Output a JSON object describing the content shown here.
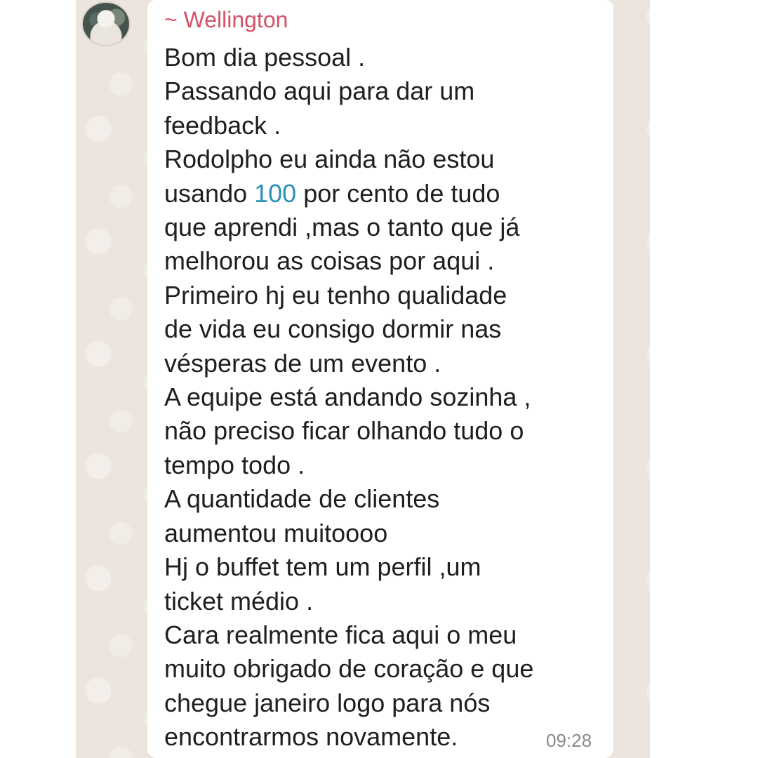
{
  "chat": {
    "wallpaper_color": "#ece5dd",
    "bubble_color": "#ffffff"
  },
  "message": {
    "sender": "~ Wellington",
    "sender_color": "#d5536a",
    "time": "09:28",
    "highlight_color": "#2b8fb4",
    "lines": [
      "Bom dia pessoal .",
      "Passando aqui para dar um",
      "feedback .",
      "Rodolpho eu ainda não estou",
      {
        "before": "usando ",
        "number": "100",
        "after": " por cento de tudo"
      },
      "que aprendi ,mas o tanto que já",
      "melhorou as coisas por aqui .",
      "Primeiro hj eu tenho qualidade",
      "de vida eu consigo dormir nas",
      "vésperas de um evento .",
      "A equipe está andando sozinha ,",
      "não preciso ficar olhando tudo o",
      "tempo todo .",
      "A quantidade de clientes",
      "aumentou muitoooo",
      "Hj o buffet tem um perfil ,um",
      "ticket médio .",
      "Cara realmente fica aqui o meu",
      "muito obrigado de coração e que",
      "chegue janeiro logo para nós",
      "encontrarmos novamente."
    ]
  }
}
